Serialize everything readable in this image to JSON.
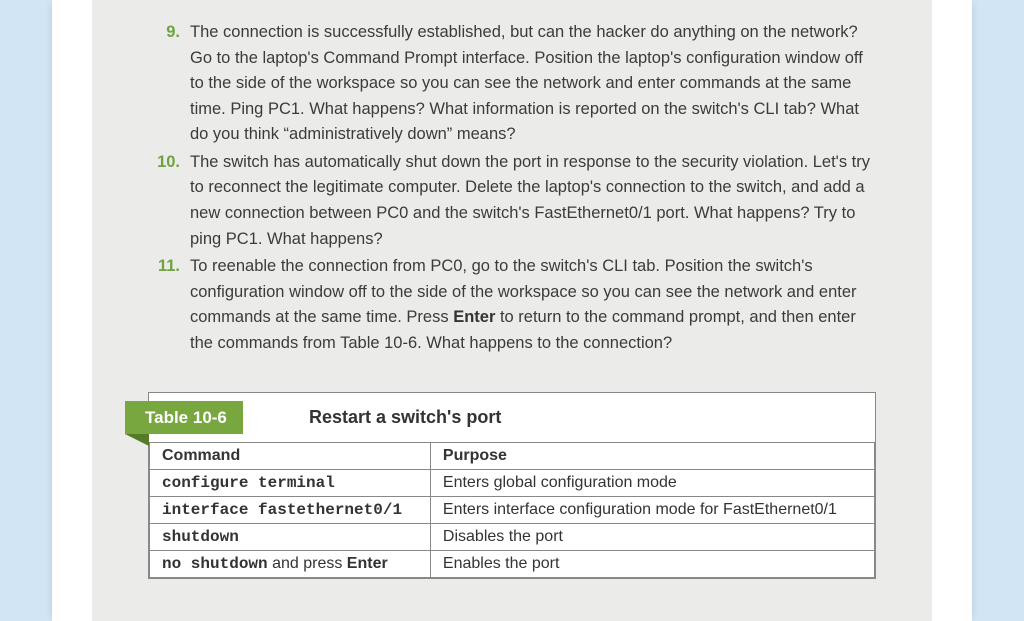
{
  "steps": [
    {
      "num": "9.",
      "html": "The connection is successfully established, but can the hacker do anything on the network? Go to the laptop's Command Prompt interface. Position the laptop's configuration window off to the side of the workspace so you can see the network and enter commands at the same time. Ping PC1. What happens? What information is reported on the switch's CLI tab? What do you think “administratively down” means?"
    },
    {
      "num": "10.",
      "html": "The switch has automatically shut down the port in response to the security violation. Let's try to reconnect the legitimate computer. Delete the laptop's connection to the switch, and add a new connection between PC0 and the switch's FastEthernet0/1 port. What happens? Try to ping PC1. What happens?"
    },
    {
      "num": "11.",
      "html": "To reenable the connection from PC0, go to the switch's CLI tab. Position the switch's configuration window off to the side of the workspace so you can see the network and enter commands at the same time. Press <b>Enter</b> to return to the command prompt, and then enter the commands from Table 10-6. What happens to the connection?"
    }
  ],
  "table": {
    "ribbon": "Table 10-6",
    "title": "Restart a switch's port",
    "headers": {
      "command": "Command",
      "purpose": "Purpose"
    },
    "rows": [
      {
        "cmd_html": "<span class=\"mono\">configure terminal</span>",
        "purpose": "Enters global configuration mode"
      },
      {
        "cmd_html": "<span class=\"mono\">interface fastethernet0/1</span>",
        "purpose": "Enters interface configuration mode for FastEthernet0/1"
      },
      {
        "cmd_html": "<span class=\"mono\">shutdown</span>",
        "purpose": "Disables the port"
      },
      {
        "cmd_html": "<span class=\"mono-last\"><span class=\"m1\">no shutdown</span> <span class=\"plain\">and press</span> <span class=\"bold\">Enter</span></span>",
        "purpose": "Enables the port"
      }
    ]
  }
}
